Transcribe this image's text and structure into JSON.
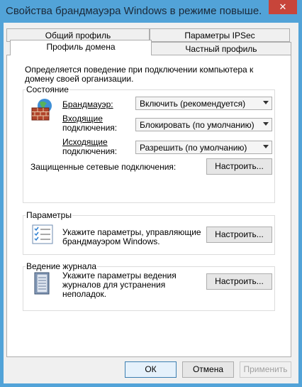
{
  "window": {
    "title": "Свойства брандмауэра Windows в режиме повыше..."
  },
  "title_bar": {
    "close_glyph": "✕"
  },
  "tabs": {
    "general_profile": "Общий профиль",
    "ipsec": "Параметры IPSec",
    "domain_profile": "Профиль домена",
    "private_profile": "Частный профиль"
  },
  "intro": "Определяется поведение при подключении компьютера к домену своей организации.",
  "state": {
    "group_label": "Состояние",
    "firewall_label": "Брандмауэр:",
    "firewall_value": "Включить (рекомендуется)",
    "inbound_label_line1": "Входящие",
    "inbound_label_line2": "подключения:",
    "inbound_value": "Блокировать (по умолчанию)",
    "outbound_label_line1": "Исходящие",
    "outbound_label_line2": "подключения:",
    "outbound_value": "Разрешить (по умолчанию)",
    "protected_label": "Защищенные сетевые подключения:",
    "configure_label": "Настроить..."
  },
  "settings": {
    "group_label": "Параметры",
    "text_line1": "Укажите параметры, управляющие",
    "text_line2": "брандмауэром Windows.",
    "configure_label": "Настроить..."
  },
  "logging": {
    "group_label": "Ведение журнала",
    "text_line1": "Укажите параметры ведения",
    "text_line2": "журналов для устранения",
    "text_line3": "неполадок.",
    "configure_label": "Настроить..."
  },
  "footer": {
    "ok_label": "ОК",
    "cancel_label": "Отмена",
    "apply_label": "Применить"
  },
  "colors": {
    "title_bar": "#52a3d8",
    "close_button": "#c7453a"
  }
}
